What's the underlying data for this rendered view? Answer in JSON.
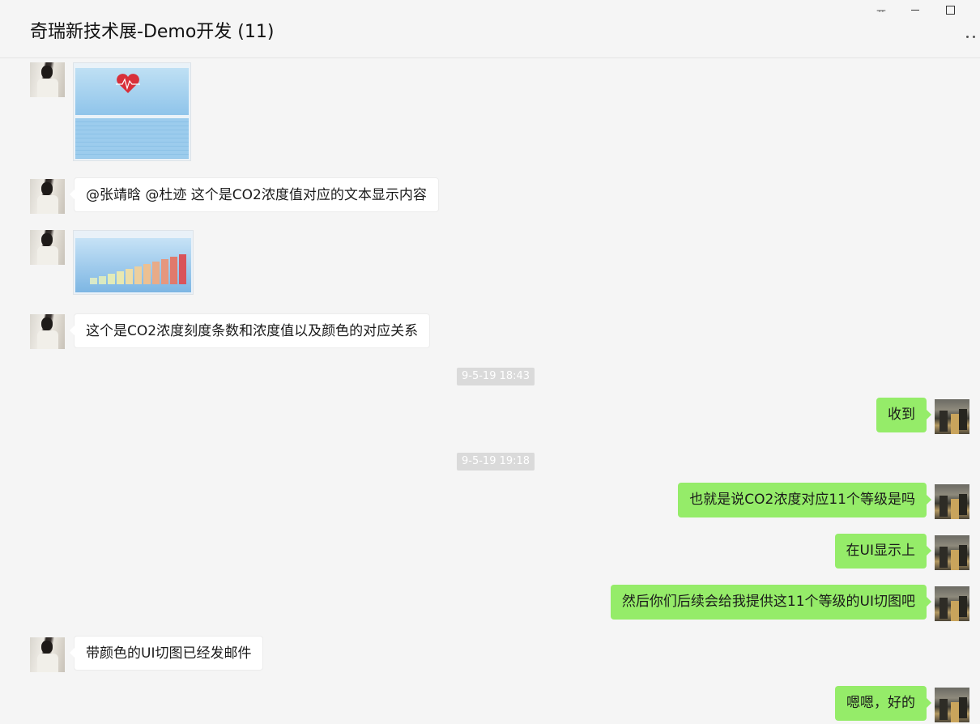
{
  "header": {
    "title": "奇瑞新技术展-Demo开发 (11)",
    "pin_glyph": "ᅲ",
    "more_label": "more"
  },
  "messages": [
    {
      "side": "left",
      "type": "image",
      "content": "image-dashboard-heart"
    },
    {
      "side": "left",
      "type": "text",
      "text": "@张靖晗 @杜迹 这个是CO2浓度值对应的文本显示内容"
    },
    {
      "side": "left",
      "type": "image",
      "content": "image-co2-level-bars"
    },
    {
      "side": "left",
      "type": "text",
      "text": "这个是CO2浓度刻度条数和浓度值以及颜色的对应关系"
    },
    {
      "type": "time",
      "text": "9-5-19 18:43"
    },
    {
      "side": "right",
      "type": "text",
      "text": "收到"
    },
    {
      "type": "time",
      "text": "9-5-19 19:18"
    },
    {
      "side": "right",
      "type": "text",
      "text": "也就是说CO2浓度对应11个等级是吗"
    },
    {
      "side": "right",
      "type": "text",
      "text": "在UI显示上"
    },
    {
      "side": "right",
      "type": "text",
      "text": "然后你们后续会给我提供这11个等级的UI切图吧"
    },
    {
      "side": "left",
      "type": "text",
      "text": "带颜色的UI切图已经发邮件"
    },
    {
      "side": "right",
      "type": "text",
      "text": "嗯嗯，好的"
    }
  ],
  "colors": {
    "background": "#f5f5f5",
    "bubble_self": "#95ec69",
    "bubble_other": "#ffffff",
    "time_badge": "#dadada"
  },
  "icons": [
    "pin-icon",
    "minimize-icon",
    "maximize-icon",
    "more-icon",
    "heart-icon"
  ]
}
